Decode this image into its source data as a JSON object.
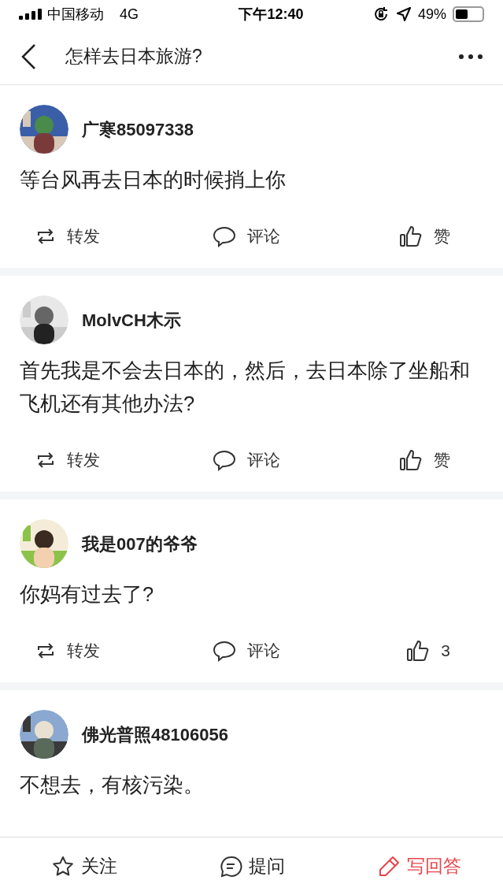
{
  "status_bar": {
    "carrier": "中国移动",
    "network": "4G",
    "time": "下午12:40",
    "battery": "49%"
  },
  "nav": {
    "title": "怎样去日本旅游?"
  },
  "posts": [
    {
      "user": "广寒85097338",
      "text": "等台风再去日本的时候捎上你",
      "actions": [
        "转发",
        "评论",
        "赞"
      ]
    },
    {
      "user": "MolvCH木示",
      "text": "首先我是不会去日本的，然后，去日本除了坐船和飞机还有其他办法?",
      "actions": [
        "转发",
        "评论",
        "赞"
      ]
    },
    {
      "user": "我是007的爷爷",
      "text": "你妈有过去了?",
      "actions": [
        "转发",
        "评论",
        "3"
      ]
    },
    {
      "user": "佛光普照48106056",
      "text": "不想去，有核污染。"
    }
  ],
  "bottom_bar": [
    {
      "label": "关注",
      "kind": "follow"
    },
    {
      "label": "提问",
      "kind": "ask"
    },
    {
      "label": "写回答",
      "kind": "answer"
    }
  ]
}
